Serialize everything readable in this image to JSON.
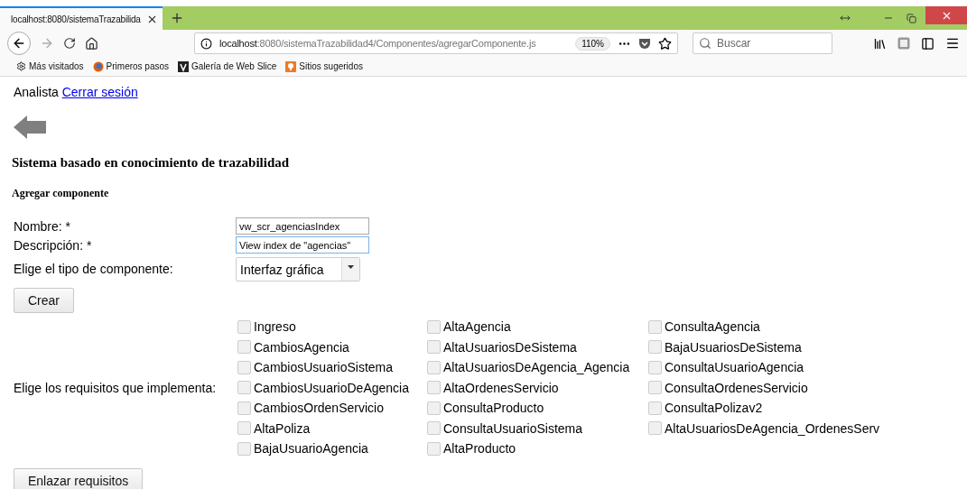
{
  "browser": {
    "tab": {
      "title": "localhost:8080/sistemaTrazabilida",
      "selected": true
    },
    "url": {
      "host": "localhost",
      "rest": ":8080/sistemaTrazabilidad4/Componentes/agregarComponente.js"
    },
    "zoom": "110%",
    "search": {
      "placeholder": "Buscar"
    },
    "bookmarks": [
      {
        "label": "Más visitados",
        "kind": "gear"
      },
      {
        "label": "Primeros pasos",
        "kind": "globe"
      },
      {
        "label": "Galería de Web Slice",
        "kind": "slice"
      },
      {
        "label": "Sitios sugeridos",
        "kind": "bulb"
      }
    ]
  },
  "page": {
    "user": "Analista",
    "logout": "Cerrar sesión",
    "title": "Sistema basado en conocimiento de trazabilidad",
    "subtitle": "Agregar componente",
    "fields": [
      {
        "label": "Nombre: *",
        "value": "vw_scr_agenciasIndex",
        "focused": false
      },
      {
        "label": "Descripción: *",
        "value": "View index de \"agencias\"",
        "focused": true
      }
    ],
    "type": {
      "label": "Elige el tipo de componente:",
      "value": "Interfaz gráfica"
    },
    "create": "Crear",
    "requirements_label": "Elige los requisitos que implementa:",
    "requirements": [
      {
        "label": "Ingreso",
        "checked": false
      },
      {
        "label": "AltaAgencia",
        "checked": false
      },
      {
        "label": "ConsultaAgencia",
        "checked": false
      },
      {
        "label": "CambiosAgencia",
        "checked": false
      },
      {
        "label": "AltaUsuariosDeSistema",
        "checked": false
      },
      {
        "label": "BajaUsuariosDeSistema",
        "checked": false
      },
      {
        "label": "CambiosUsuarioSistema",
        "checked": false
      },
      {
        "label": "AltaUsuariosDeAgencia_Agencia",
        "checked": false
      },
      {
        "label": "ConsultaUsuarioAgencia",
        "checked": false
      },
      {
        "label": "CambiosUsuarioDeAgencia",
        "checked": false
      },
      {
        "label": "AltaOrdenesServicio",
        "checked": false
      },
      {
        "label": "ConsultaOrdenesServicio",
        "checked": false
      },
      {
        "label": "CambiosOrdenServicio",
        "checked": false
      },
      {
        "label": "ConsultaProducto",
        "checked": false
      },
      {
        "label": "ConsultaPolizav2",
        "checked": false
      },
      {
        "label": "AltaPoliza",
        "checked": false
      },
      {
        "label": "ConsultaUsuarioSistema",
        "checked": false
      },
      {
        "label": "AltaUsuariosDeAgencia_OrdenesServ",
        "checked": false
      },
      {
        "label": "BajaUsuarioAgencia",
        "checked": false
      },
      {
        "label": "AltaProducto",
        "checked": false
      }
    ],
    "link_button": "Enlazar requisitos"
  }
}
